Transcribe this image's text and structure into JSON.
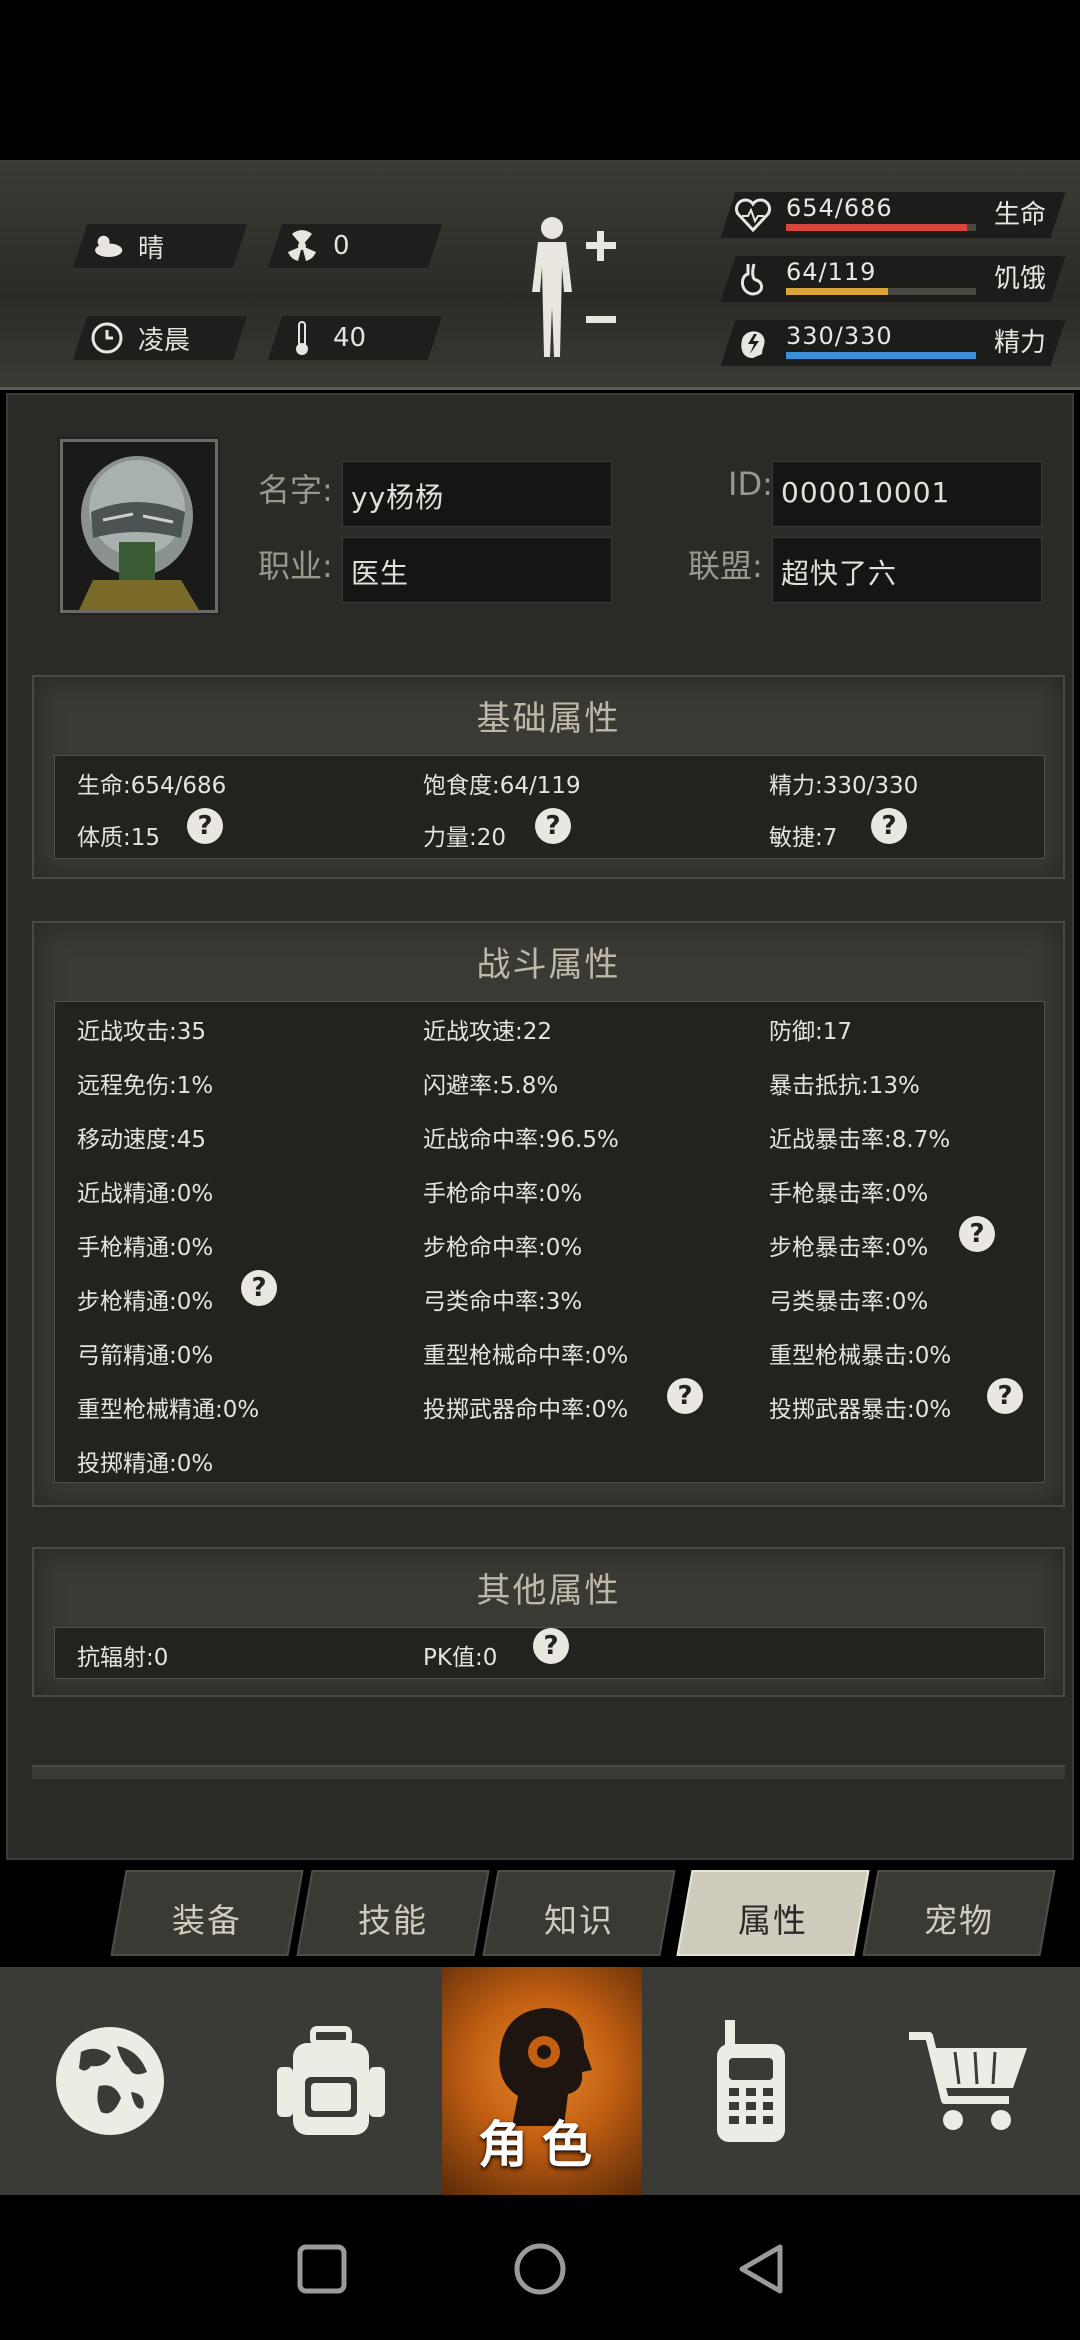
{
  "hud": {
    "weather": "晴",
    "radiation": "0",
    "time_of_day": "凌晨",
    "temperature": "40",
    "vitals": [
      {
        "value": "654/686",
        "name": "生命",
        "fill": 0.953,
        "color": "#d9443b"
      },
      {
        "value": "64/119",
        "name": "饥饿",
        "fill": 0.538,
        "color": "#d9a53b"
      },
      {
        "value": "330/330",
        "name": "精力",
        "fill": 1.0,
        "color": "#3b8fd9"
      }
    ]
  },
  "profile": {
    "name_label": "名字:",
    "name_value": "yy杨杨",
    "id_label": "ID:",
    "id_value": "000010001",
    "job_label": "职业:",
    "job_value": "医生",
    "alliance_label": "联盟:",
    "alliance_value": "超快了六"
  },
  "basic": {
    "title": "基础属性",
    "items": [
      "生命:654/686",
      "饱食度:64/119",
      "精力:330/330",
      "体质:15",
      "力量:20",
      "敏捷:7"
    ]
  },
  "combat": {
    "title": "战斗属性",
    "items": [
      "近战攻击:35",
      "近战攻速:22",
      "防御:17",
      "远程免伤:1%",
      "闪避率:5.8%",
      "暴击抵抗:13%",
      "移动速度:45",
      "近战命中率:96.5%",
      "近战暴击率:8.7%",
      "近战精通:0%",
      "手枪命中率:0%",
      "手枪暴击率:0%",
      "手枪精通:0%",
      "步枪命中率:0%",
      "步枪暴击率:0%",
      "步枪精通:0%",
      "弓类命中率:3%",
      "弓类暴击率:0%",
      "弓箭精通:0%",
      "重型枪械命中率:0%",
      "重型枪械暴击:0%",
      "重型枪械精通:0%",
      "投掷武器命中率:0%",
      "投掷武器暴击:0%",
      "投掷精通:0%"
    ]
  },
  "other": {
    "title": "其他属性",
    "items": [
      "抗辐射:0",
      "PK值:0"
    ]
  },
  "help_glyph": "?",
  "tabs": [
    "装备",
    "技能",
    "知识",
    "属性",
    "宠物"
  ],
  "active_tab": "属性",
  "nav": {
    "items": [
      "globe-icon",
      "backpack-icon",
      "character-icon",
      "radio-icon",
      "cart-icon"
    ],
    "active_label": "角色"
  }
}
